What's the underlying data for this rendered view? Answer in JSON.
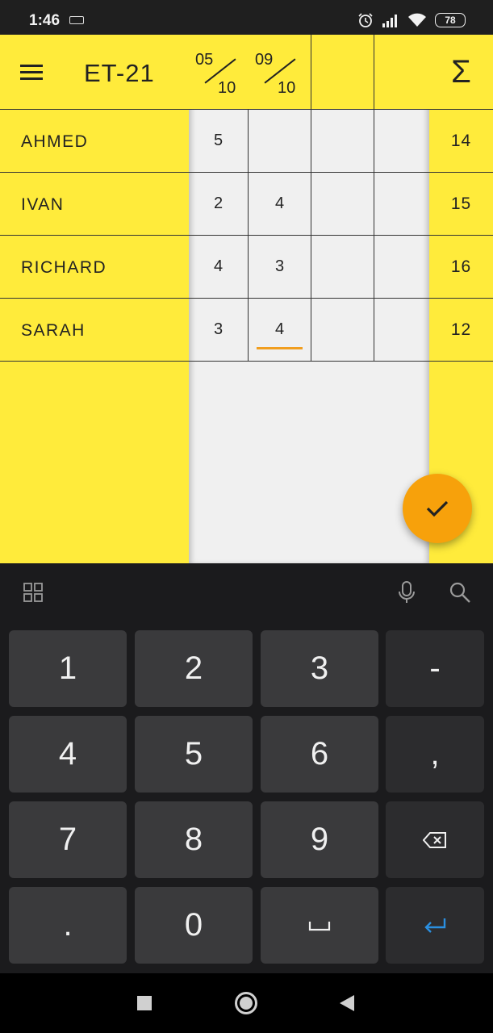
{
  "status_bar": {
    "time": "1:46",
    "battery": "78"
  },
  "header": {
    "title": "ET-21",
    "sum_symbol": "Σ"
  },
  "dates": [
    {
      "top": "05",
      "bottom": "10"
    },
    {
      "top": "09",
      "bottom": "10"
    },
    {
      "top": "",
      "bottom": ""
    },
    {
      "top": "",
      "bottom": ""
    }
  ],
  "students": [
    {
      "name": "AHMED",
      "grades": [
        "5",
        "",
        "",
        ""
      ],
      "sum": "14"
    },
    {
      "name": "IVAN",
      "grades": [
        "2",
        "4",
        "",
        ""
      ],
      "sum": "15"
    },
    {
      "name": "RICHARD",
      "grades": [
        "4",
        "3",
        "",
        ""
      ],
      "sum": "16"
    },
    {
      "name": "SARAH",
      "grades": [
        "3",
        "4",
        "",
        ""
      ],
      "sum": "12"
    }
  ],
  "keyboard": {
    "rows": [
      [
        "1",
        "2",
        "3",
        "-"
      ],
      [
        "4",
        "5",
        "6",
        ","
      ],
      [
        "7",
        "8",
        "9",
        "backspace"
      ],
      [
        ".",
        "0",
        "space",
        "enter"
      ]
    ]
  },
  "icons": {
    "menu": "menu-icon",
    "fab": "check-icon",
    "toolbar": [
      "grid-icon",
      "mic-icon",
      "search-icon"
    ],
    "nav": [
      "recents-square-icon",
      "home-circle-icon",
      "back-triangle-icon"
    ]
  },
  "colors": {
    "accent_yellow": "#ffeb3b",
    "fab_orange": "#f7a10b",
    "active_underline": "#f19e1f",
    "enter_blue": "#2a8fe0"
  }
}
